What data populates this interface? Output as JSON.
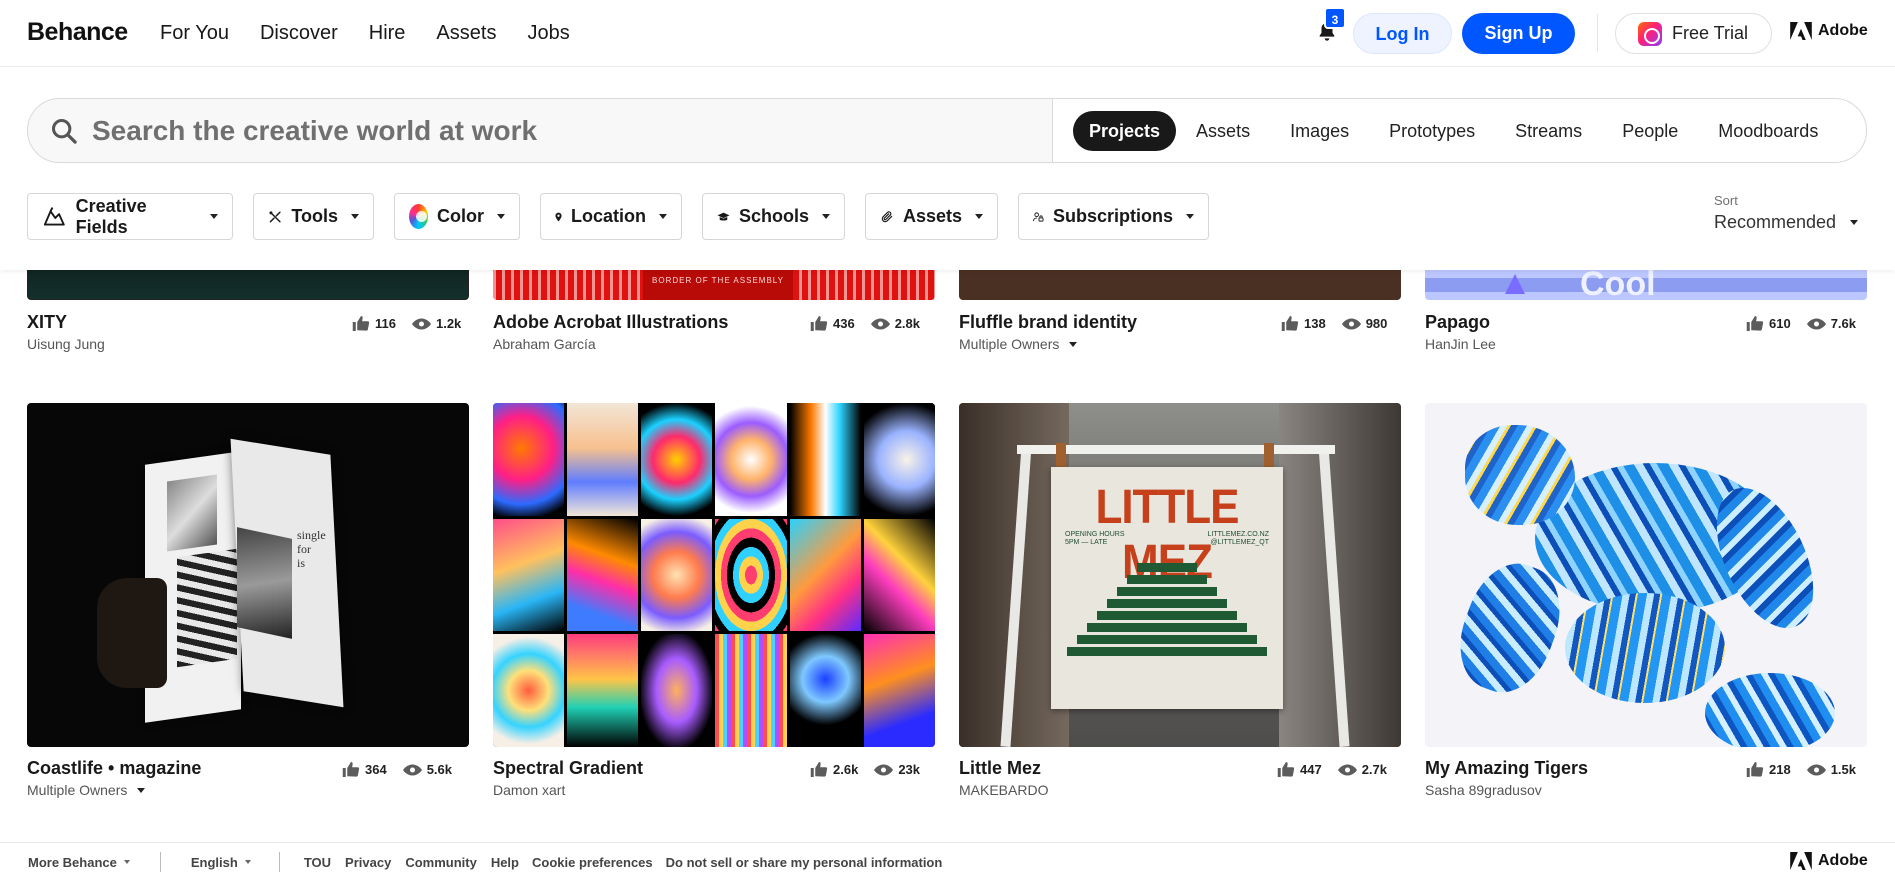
{
  "brand": "Behance",
  "nav": {
    "links": [
      "For You",
      "Discover",
      "Hire",
      "Assets",
      "Jobs"
    ],
    "notification_count": "3",
    "login": "Log In",
    "signup": "Sign Up",
    "free_trial": "Free Trial",
    "adobe": "Adobe"
  },
  "search": {
    "placeholder": "Search the creative world at work",
    "tabs": [
      "Projects",
      "Assets",
      "Images",
      "Prototypes",
      "Streams",
      "People",
      "Moodboards"
    ],
    "active_tab": "Projects"
  },
  "filters": [
    {
      "label": "Creative Fields",
      "icon": "creative-fields-icon"
    },
    {
      "label": "Tools",
      "icon": "tools-icon"
    },
    {
      "label": "Color",
      "icon": "color-wheel-icon"
    },
    {
      "label": "Location",
      "icon": "location-pin-icon"
    },
    {
      "label": "Schools",
      "icon": "graduation-cap-icon"
    },
    {
      "label": "Assets",
      "icon": "paperclip-icon"
    },
    {
      "label": "Subscriptions",
      "icon": "user-lock-icon"
    }
  ],
  "sort": {
    "label": "Sort",
    "value": "Recommended"
  },
  "row1": [
    {
      "title": "XITY",
      "owner": "Uisung Jung",
      "likes": "116",
      "views": "1.2k",
      "multiple": false
    },
    {
      "title": "Adobe Acrobat Illustrations",
      "owner": "Abraham García",
      "likes": "436",
      "views": "2.8k",
      "multiple": false
    },
    {
      "title": "Fluffle brand identity",
      "owner": "Multiple Owners",
      "likes": "138",
      "views": "980",
      "multiple": true
    },
    {
      "title": "Papago",
      "owner": "HanJin Lee",
      "likes": "610",
      "views": "7.6k",
      "multiple": false
    }
  ],
  "row2": [
    {
      "title": "Coastlife • magazine",
      "owner": "Multiple Owners",
      "likes": "364",
      "views": "5.6k",
      "multiple": true
    },
    {
      "title": "Spectral Gradient",
      "owner": "Damon xart",
      "likes": "2.6k",
      "views": "23k",
      "multiple": false
    },
    {
      "title": "Little Mez",
      "owner": "MAKEBARDO",
      "likes": "447",
      "views": "2.7k",
      "multiple": false
    },
    {
      "title": "My Amazing Tigers",
      "owner": "Sasha 89gradusov",
      "likes": "218",
      "views": "1.5k",
      "multiple": false
    }
  ],
  "thumb_text": {
    "acrobat_caption": "BORDER OF THE ASSEMBLY",
    "papago_word": "Cool",
    "mez_title": "LITTLE MEZ",
    "mez_hours": "OPENING HOURS\n5PM — LATE",
    "mez_web": "LITTLEMEZ.CO.NZ\n@LITTLEMEZ_QT",
    "magazine_text": "single\nfor\nis"
  },
  "footer": {
    "more": "More Behance",
    "language": "English",
    "links": [
      "TOU",
      "Privacy",
      "Community",
      "Help",
      "Cookie preferences",
      "Do not sell or share my personal information"
    ],
    "adobe": "Adobe"
  }
}
